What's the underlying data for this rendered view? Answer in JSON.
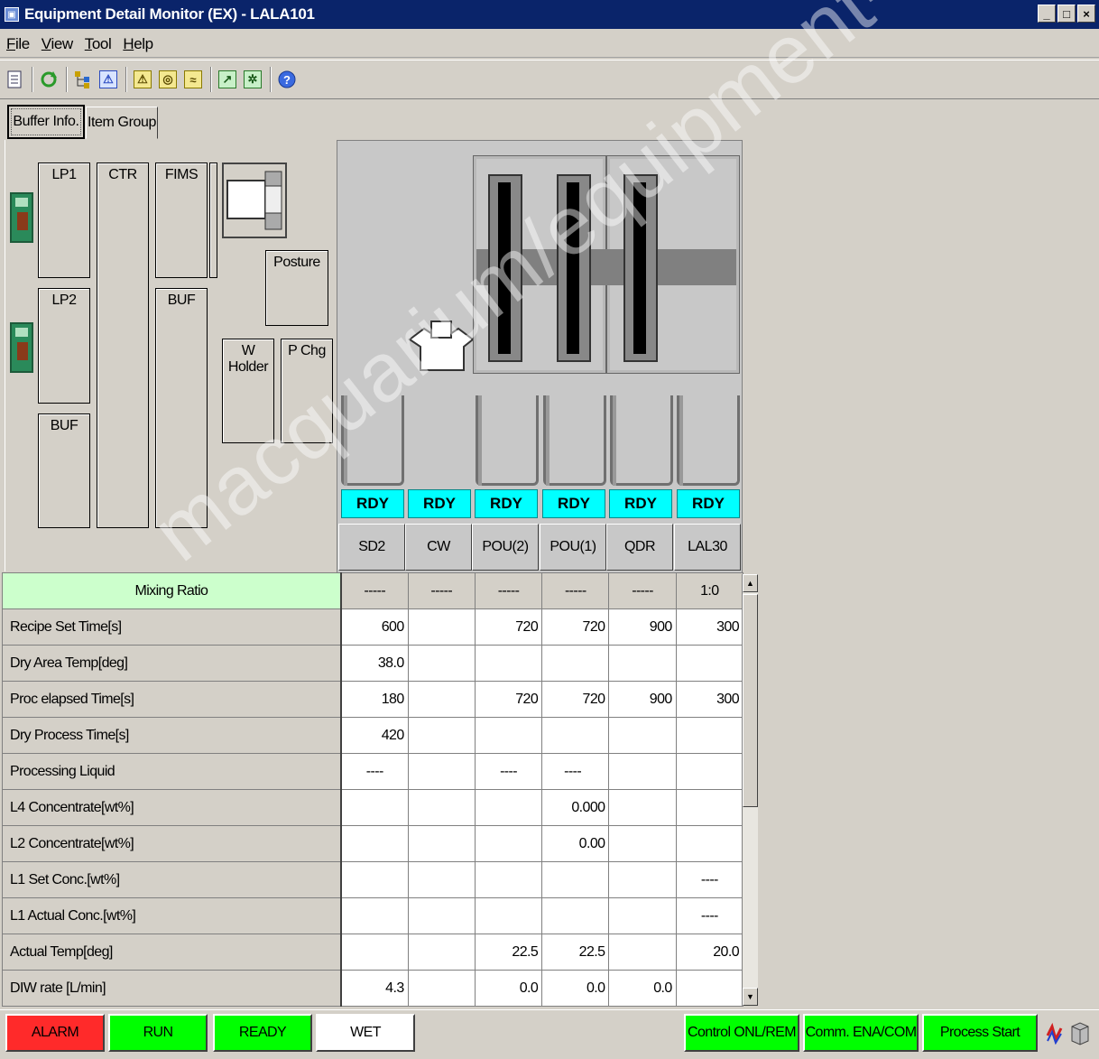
{
  "window": {
    "title": "Equipment Detail Monitor (EX) - LALA101",
    "min": "_",
    "max": "□",
    "close": "×"
  },
  "menu": [
    "File",
    "View",
    "Tool",
    "Help"
  ],
  "tabs": [
    {
      "label": "Buffer Info.",
      "active": true
    },
    {
      "label": "Item Group",
      "active": false
    }
  ],
  "buffer": {
    "lp1": "LP1",
    "lp2": "LP2",
    "buf_left": "BUF",
    "ctr": "CTR",
    "fims": "FIMS",
    "buf_right": "BUF",
    "posture": "Posture",
    "w_holder": "W Holder",
    "p_chg": "P Chg"
  },
  "units": [
    {
      "name": "SD2",
      "status": "RDY"
    },
    {
      "name": "CW",
      "status": "RDY"
    },
    {
      "name": "POU(2)",
      "status": "RDY"
    },
    {
      "name": "POU(1)",
      "status": "RDY"
    },
    {
      "name": "QDR",
      "status": "RDY"
    },
    {
      "name": "LAL30",
      "status": "RDY"
    }
  ],
  "table": {
    "header": {
      "label": "Mixing Ratio",
      "values": [
        "-----",
        "-----",
        "-----",
        "-----",
        "-----",
        "1:0"
      ]
    },
    "rows": [
      {
        "label": "Recipe Set Time[s]",
        "values": [
          "600",
          "",
          "720",
          "720",
          "900",
          "300"
        ]
      },
      {
        "label": "Dry Area Temp[deg]",
        "values": [
          "38.0",
          "",
          "",
          "",
          "",
          ""
        ]
      },
      {
        "label": "Proc elapsed Time[s]",
        "values": [
          "180",
          "",
          "720",
          "720",
          "900",
          "300"
        ]
      },
      {
        "label": "Dry Process Time[s]",
        "values": [
          "420",
          "",
          "",
          "",
          "",
          ""
        ]
      },
      {
        "label": "Processing Liquid",
        "values": [
          "----",
          "",
          "----",
          "----",
          "",
          ""
        ]
      },
      {
        "label": "L4 Concentrate[wt%]",
        "values": [
          "",
          "",
          "",
          "0.000",
          "",
          ""
        ]
      },
      {
        "label": "L2 Concentrate[wt%]",
        "values": [
          "",
          "",
          "",
          "0.00",
          "",
          ""
        ]
      },
      {
        "label": "L1 Set Conc.[wt%]",
        "values": [
          "",
          "",
          "",
          "",
          "",
          "----"
        ]
      },
      {
        "label": "L1 Actual Conc.[wt%]",
        "values": [
          "",
          "",
          "",
          "",
          "",
          "----"
        ]
      },
      {
        "label": "Actual Temp[deg]",
        "values": [
          "",
          "",
          "22.5",
          "22.5",
          "",
          "20.0"
        ]
      },
      {
        "label": "DIW rate [L/min]",
        "values": [
          "4.3",
          "",
          "0.0",
          "0.0",
          "0.0",
          ""
        ]
      }
    ]
  },
  "statusbar": {
    "alarm": "ALARM",
    "run": "RUN",
    "ready": "READY",
    "wet": "WET",
    "control": "Control ONL/REM",
    "comm": "Comm. ENA/COM",
    "process": "Process Start"
  },
  "colors": {
    "alarm": "#ff2a2a",
    "green": "#00ff00",
    "rdy": "#00ffff",
    "title_bar": "#0a246a",
    "mixing_header": "#ccffcc"
  },
  "watermark": "macquarium/equipment-trading"
}
